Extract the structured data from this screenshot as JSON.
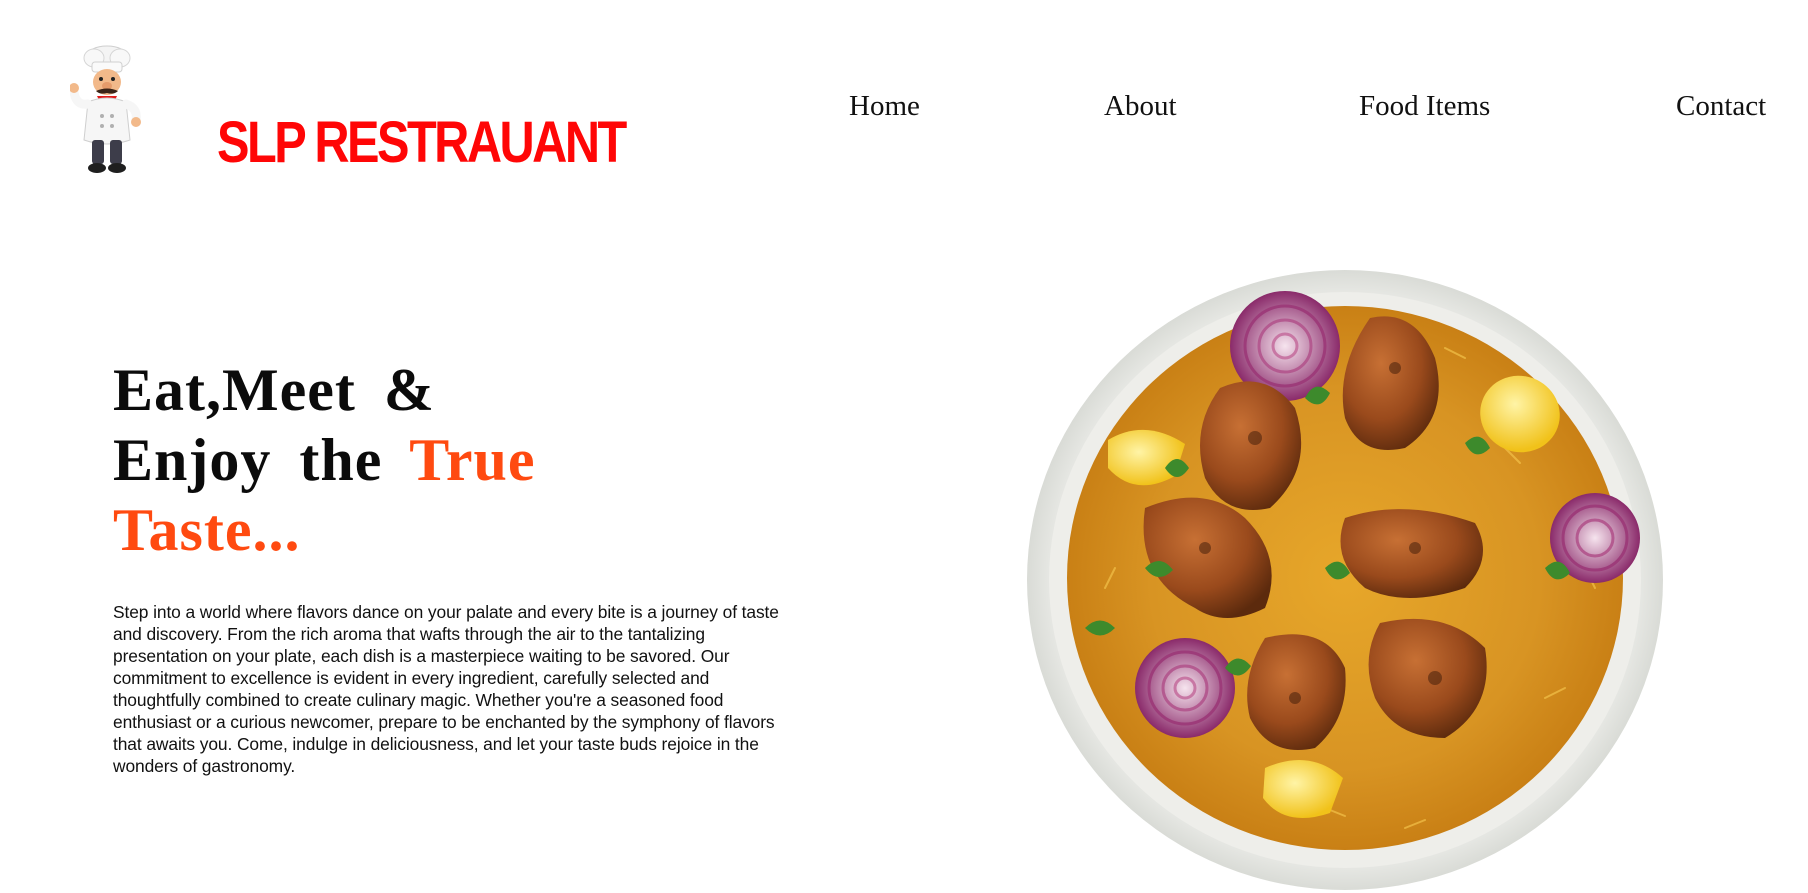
{
  "header": {
    "brand_name": "SLP RESTRAUANT",
    "logo_icon": "chef-mascot-icon",
    "nav": [
      {
        "label": "Home"
      },
      {
        "label": "About"
      },
      {
        "label": "Food Items"
      },
      {
        "label": "Contact"
      }
    ]
  },
  "hero": {
    "headline_line1": "Eat,Meet &",
    "headline_line2_plain": "Enjoy the",
    "headline_line2_accent": "True",
    "headline_line3_accent": "Taste...",
    "description": "Step into a world where flavors dance on your palate and every bite is a journey of taste and discovery. From the rich aroma that wafts through the air to the tantalizing presentation on your plate, each dish is a masterpiece waiting to be savored. Our commitment to excellence is evident in every ingredient, carefully selected and thoughtfully combined to create culinary magic. Whether you're a seasoned food enthusiast or a curious newcomer, prepare to be enchanted by the symphony of flavors that awaits you. Come, indulge in deliciousness, and let your taste buds rejoice in the wonders of gastronomy.",
    "image_icon": "biryani-plate-image"
  },
  "colors": {
    "brand_red": "#ff0606",
    "accent_orange": "#ff4a10",
    "text_dark": "#0b0b0b",
    "background": "#ffffff"
  }
}
